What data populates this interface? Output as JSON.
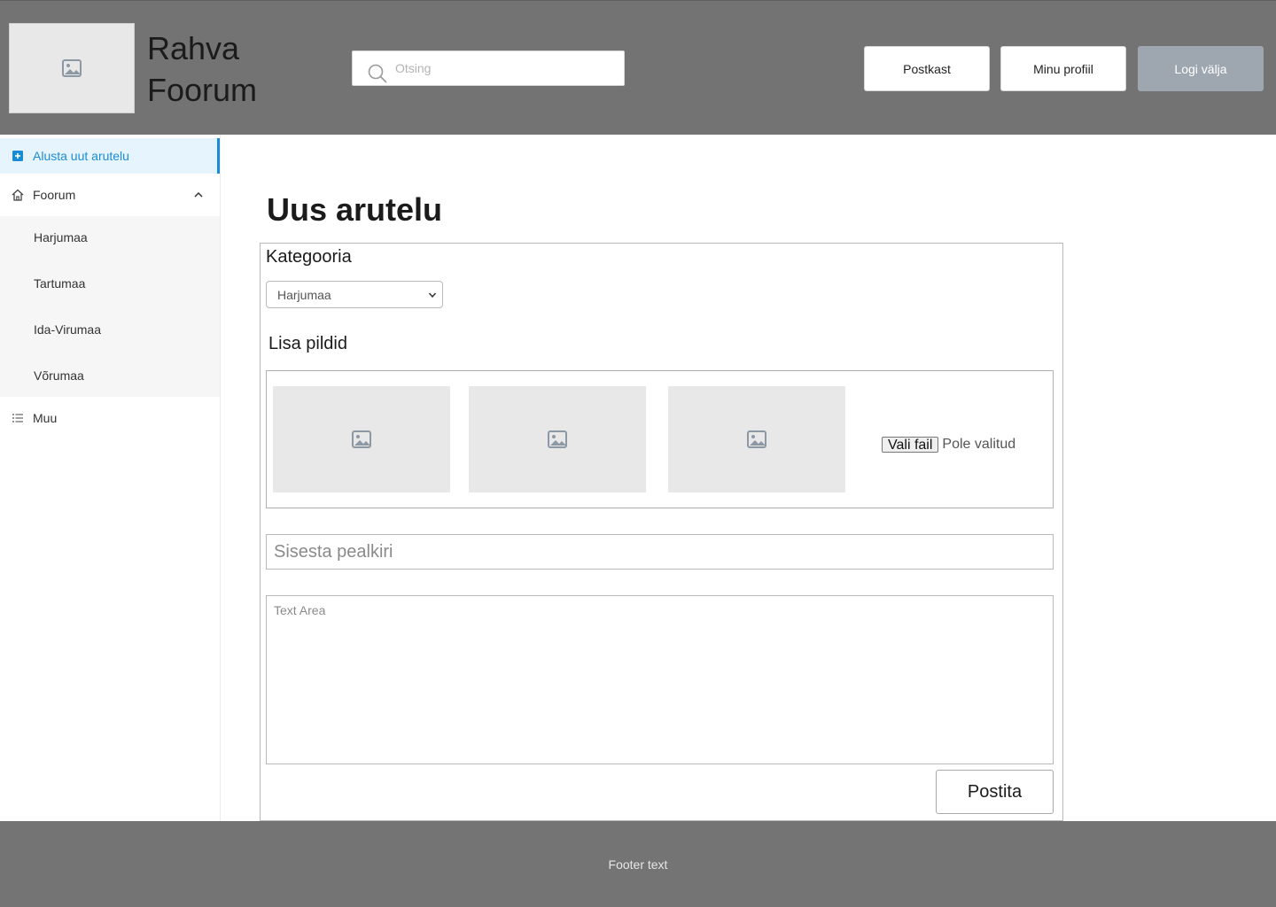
{
  "header": {
    "site_title_line1": "Rahva",
    "site_title_line2": "Foorum",
    "search_placeholder": "Otsing",
    "buttons": {
      "inbox": "Postkast",
      "profile": "Minu profiil",
      "logout": "Logi välja"
    }
  },
  "sidebar": {
    "new_discussion": "Alusta uut arutelu",
    "forum": "Foorum",
    "regions": [
      "Harjumaa",
      "Tartumaa",
      "Ida-Virumaa",
      "Võrumaa"
    ],
    "other": "Muu"
  },
  "main": {
    "title": "Uus arutelu",
    "category_label": "Kategooria",
    "category_selected": "Harjumaa",
    "images_label": "Lisa pildid",
    "file_button": "Vali fail",
    "file_status": "Pole valitud",
    "title_placeholder": "Sisesta pealkiri",
    "textarea_placeholder": "Text Area",
    "post_button": "Postita"
  },
  "footer": {
    "text": "Footer text"
  },
  "colors": {
    "header_bg": "#737373",
    "accent": "#1c8bd6",
    "logout_bg": "#9ea7b0"
  }
}
